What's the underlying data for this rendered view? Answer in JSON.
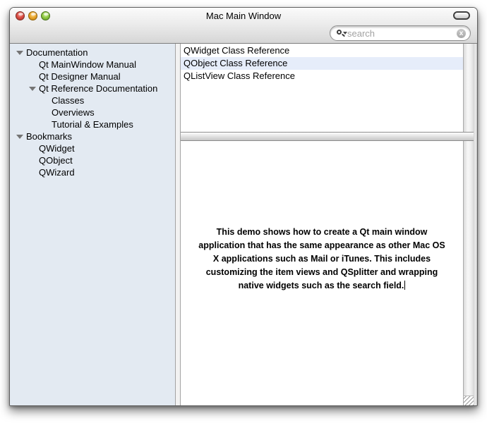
{
  "window": {
    "title": "Mac Main Window",
    "controls": {
      "close": "close",
      "minimize": "minimize",
      "zoom": "zoom",
      "toolbar_toggle": "toolbar-toggle-pill"
    }
  },
  "toolbar": {
    "search": {
      "placeholder": "search",
      "value": "",
      "clear_label": "x"
    }
  },
  "sidebar": {
    "items": [
      {
        "label": "Documentation",
        "level": 0,
        "expandable": true
      },
      {
        "label": "Qt MainWindow Manual",
        "level": 1,
        "expandable": false
      },
      {
        "label": "Qt Designer Manual",
        "level": 1,
        "expandable": false
      },
      {
        "label": "Qt Reference Documentation",
        "level": 1,
        "expandable": true
      },
      {
        "label": "Classes",
        "level": 2,
        "expandable": false
      },
      {
        "label": "Overviews",
        "level": 2,
        "expandable": false
      },
      {
        "label": "Tutorial & Examples",
        "level": 2,
        "expandable": false
      },
      {
        "label": "Bookmarks",
        "level": 0,
        "expandable": true
      },
      {
        "label": "QWidget",
        "level": 1,
        "expandable": false
      },
      {
        "label": "QObject",
        "level": 1,
        "expandable": false
      },
      {
        "label": "QWizard",
        "level": 1,
        "expandable": false
      }
    ]
  },
  "list": {
    "items": [
      {
        "label": "QWidget Class Reference",
        "selected": false
      },
      {
        "label": "QObject Class Reference",
        "selected": true
      },
      {
        "label": "QListView Class Reference",
        "selected": false
      }
    ]
  },
  "editor": {
    "text": "This demo shows how to create a Qt main window\napplication that has the same appearance as other Mac OS\nX applications such as Mail or iTunes. This includes\ncustomizing the item views and QSplitter and wrapping\nnative widgets such as the search field."
  },
  "colors": {
    "sidebar_bg": "#e3eaf2",
    "selection_bg": "#e6edfa",
    "close_button": "#dd5047",
    "minimize_button": "#ecaa32",
    "zoom_button": "#93cb47"
  }
}
